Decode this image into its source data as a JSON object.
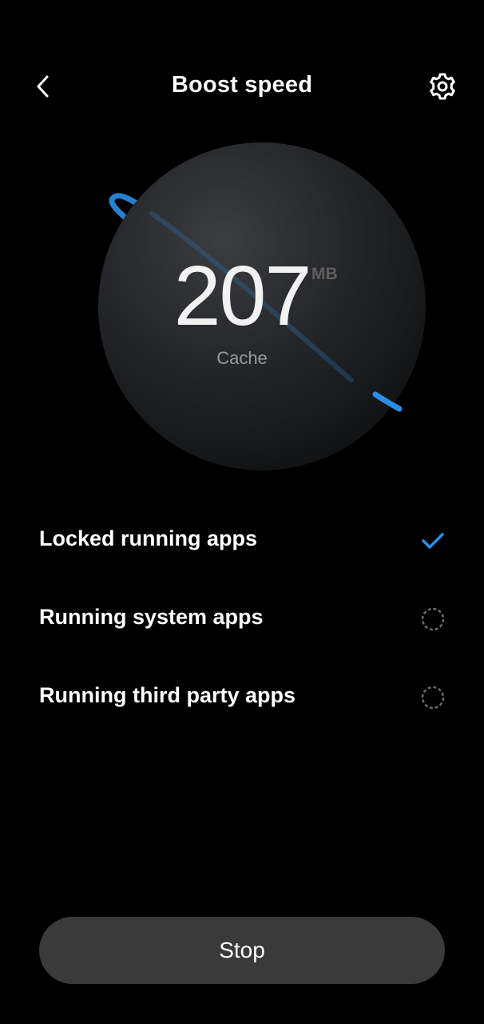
{
  "header": {
    "title": "Boost speed",
    "back_icon": "chevron-left-icon",
    "settings_icon": "gear-icon"
  },
  "cache": {
    "value": "207",
    "unit": "MB",
    "label": "Cache"
  },
  "tasks": [
    {
      "label": "Locked running apps",
      "status": "done",
      "status_icon": "checkmark-icon"
    },
    {
      "label": "Running system apps",
      "status": "loading",
      "status_icon": "spinner-icon"
    },
    {
      "label": "Running third party apps",
      "status": "loading",
      "status_icon": "spinner-icon"
    }
  ],
  "actions": {
    "stop_label": "Stop"
  },
  "colors": {
    "background": "#000000",
    "accent": "#2a8ee8",
    "button_bg": "#3a3a3a",
    "muted_text": "#9a9a9a"
  }
}
